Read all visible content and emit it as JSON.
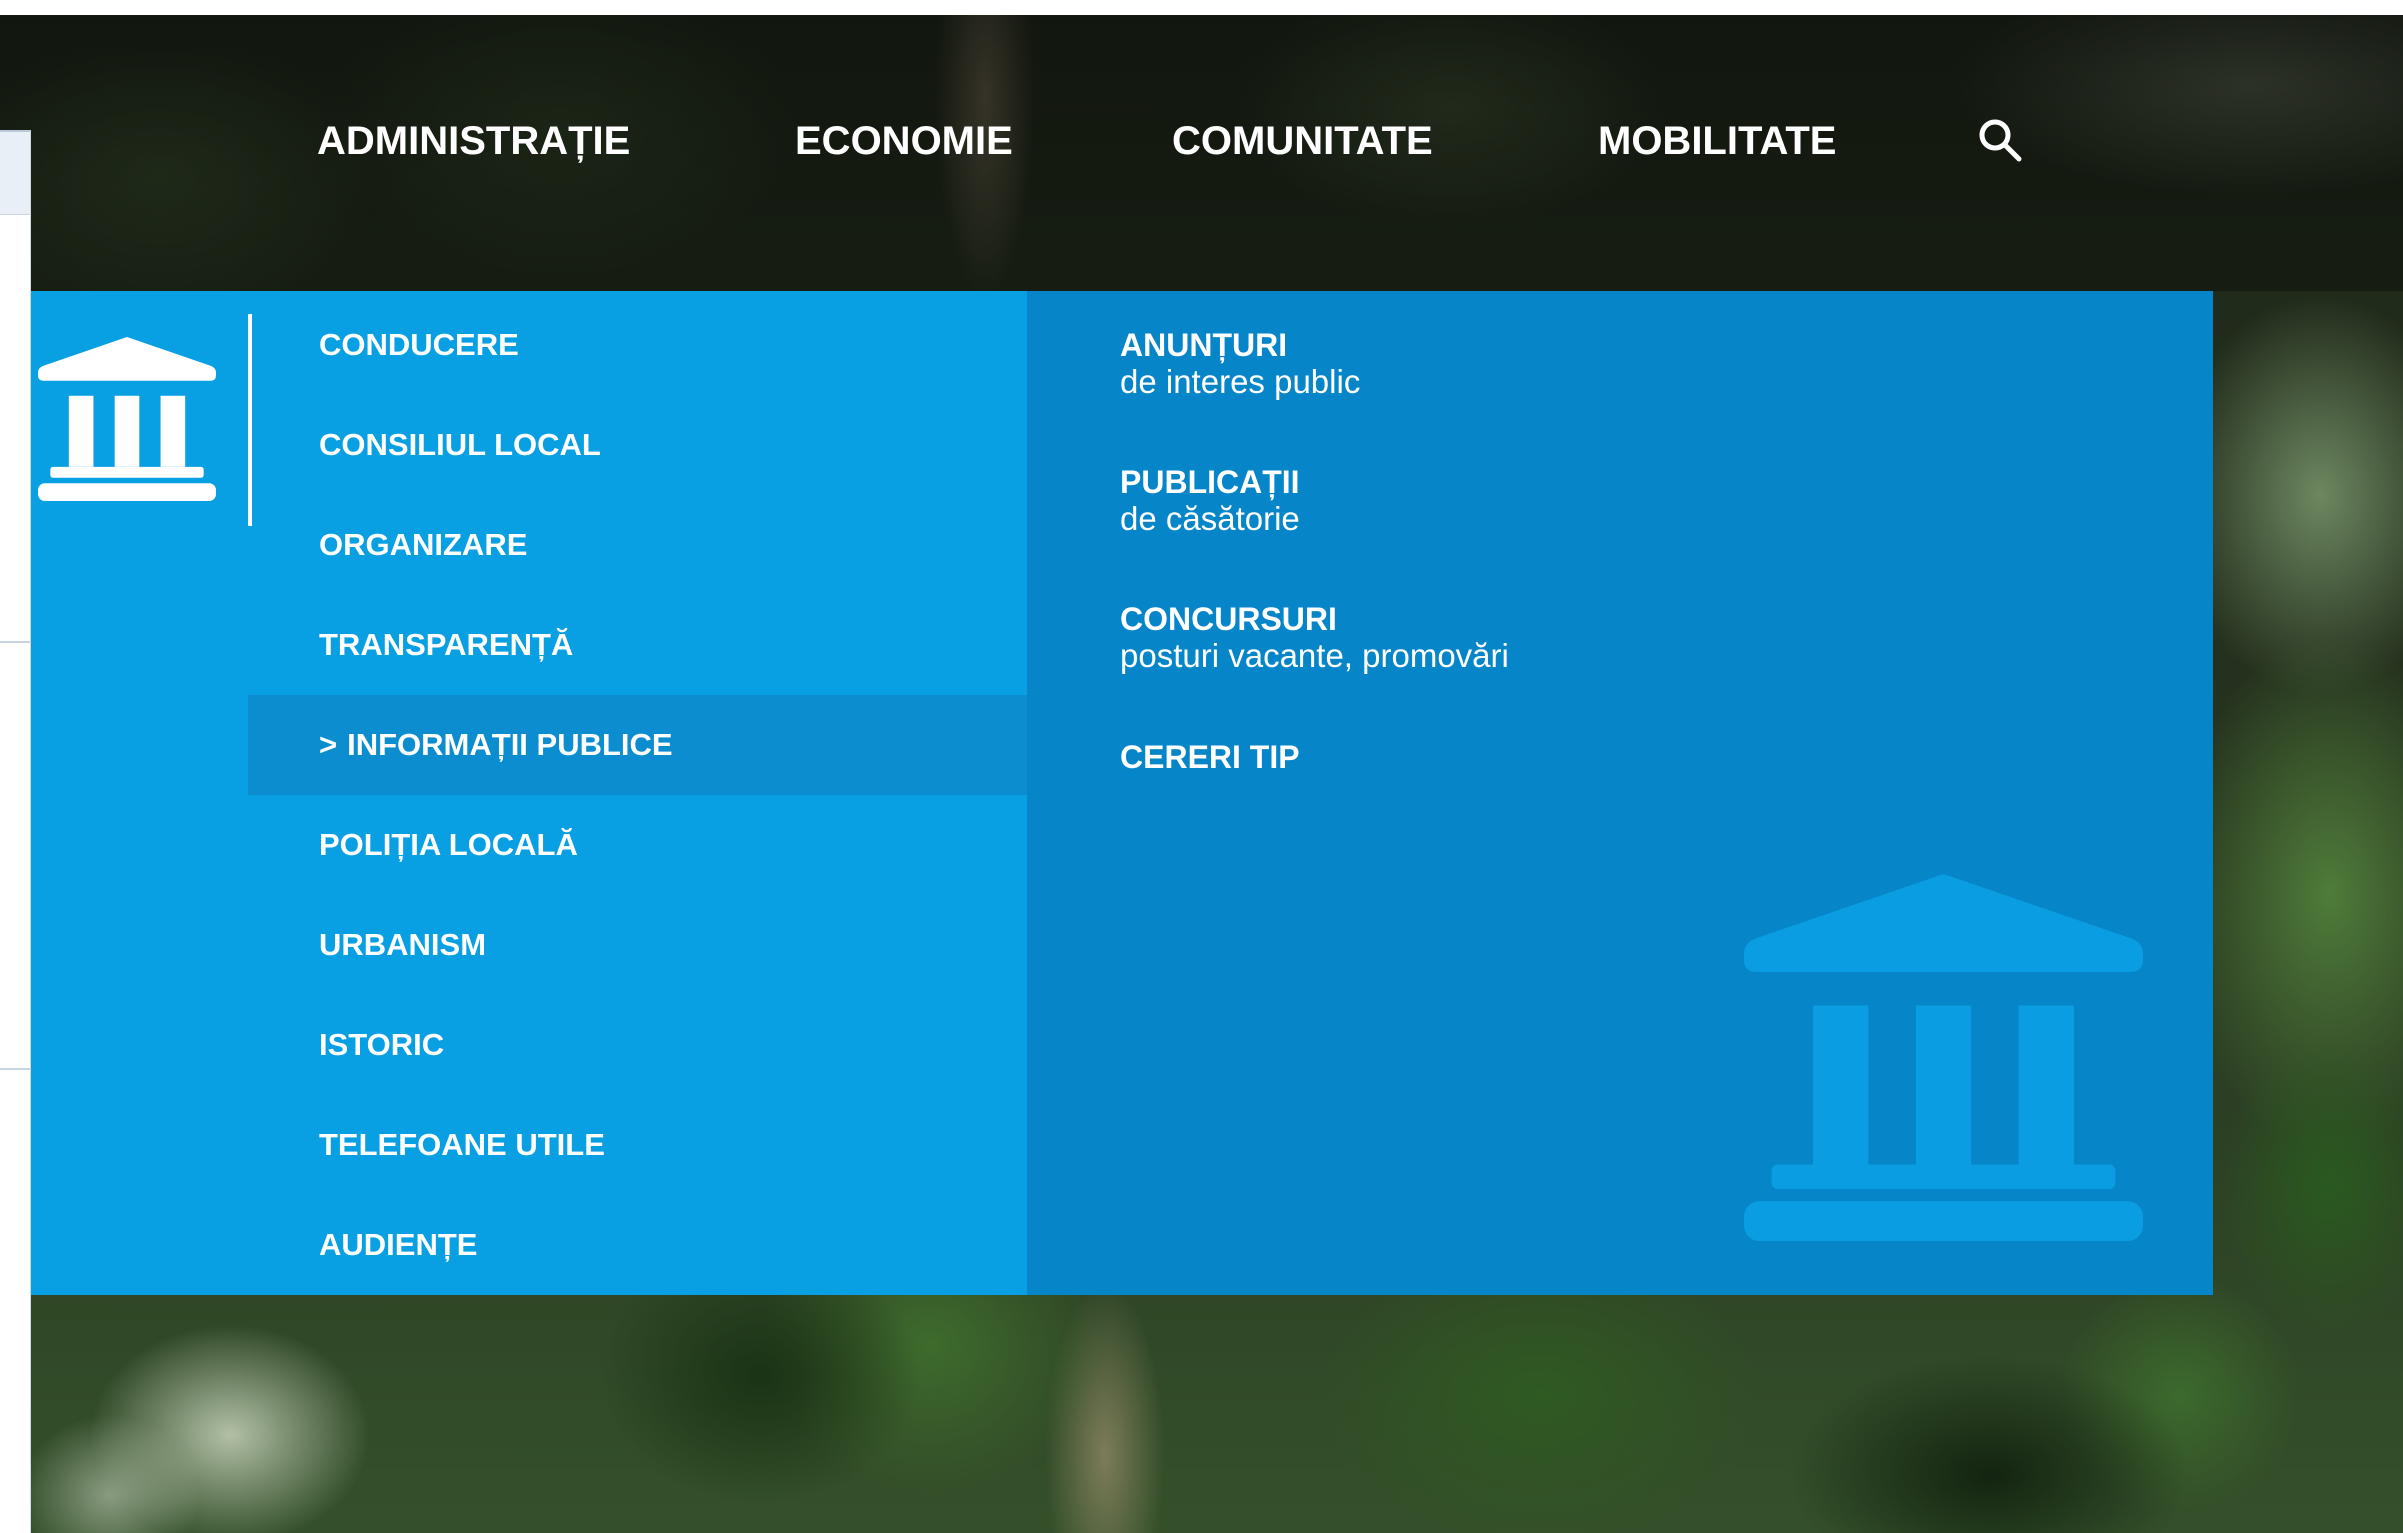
{
  "theme": {
    "menu_bg": "#089fe3",
    "submenu_bg": "#0686c9",
    "active_item_bg": "#0b8dd0",
    "watermark_color": "#0a9de2",
    "text_color": "#ffffff"
  },
  "nav": {
    "items": [
      {
        "label": "ADMINISTRAȚIE"
      },
      {
        "label": "ECONOMIE"
      },
      {
        "label": "COMUNITATE"
      },
      {
        "label": "MOBILITATE"
      }
    ],
    "search_icon": "search-icon"
  },
  "dropdown": {
    "section_icon": "city-hall-icon",
    "menu": [
      {
        "label": "CONDUCERE",
        "active": false
      },
      {
        "label": "CONSILIUL LOCAL",
        "active": false
      },
      {
        "label": "ORGANIZARE",
        "active": false
      },
      {
        "label": "TRANSPARENȚĂ",
        "active": false
      },
      {
        "label": "INFORMAȚII PUBLICE",
        "prefix": ">",
        "active": true
      },
      {
        "label": "POLIȚIA LOCALĂ",
        "active": false
      },
      {
        "label": "URBANISM",
        "active": false
      },
      {
        "label": "ISTORIC",
        "active": false
      },
      {
        "label": "TELEFOANE UTILE",
        "active": false
      },
      {
        "label": "AUDIENȚE",
        "active": false
      }
    ],
    "submenu": [
      {
        "title": "ANUNȚURI",
        "subtitle": "de interes public"
      },
      {
        "title": "PUBLICAȚII",
        "subtitle": "de căsătorie"
      },
      {
        "title": "CONCURSURI",
        "subtitle": "posturi vacante, promovări"
      },
      {
        "title": "CERERI TIP"
      }
    ],
    "watermark_icon": "city-hall-icon"
  }
}
